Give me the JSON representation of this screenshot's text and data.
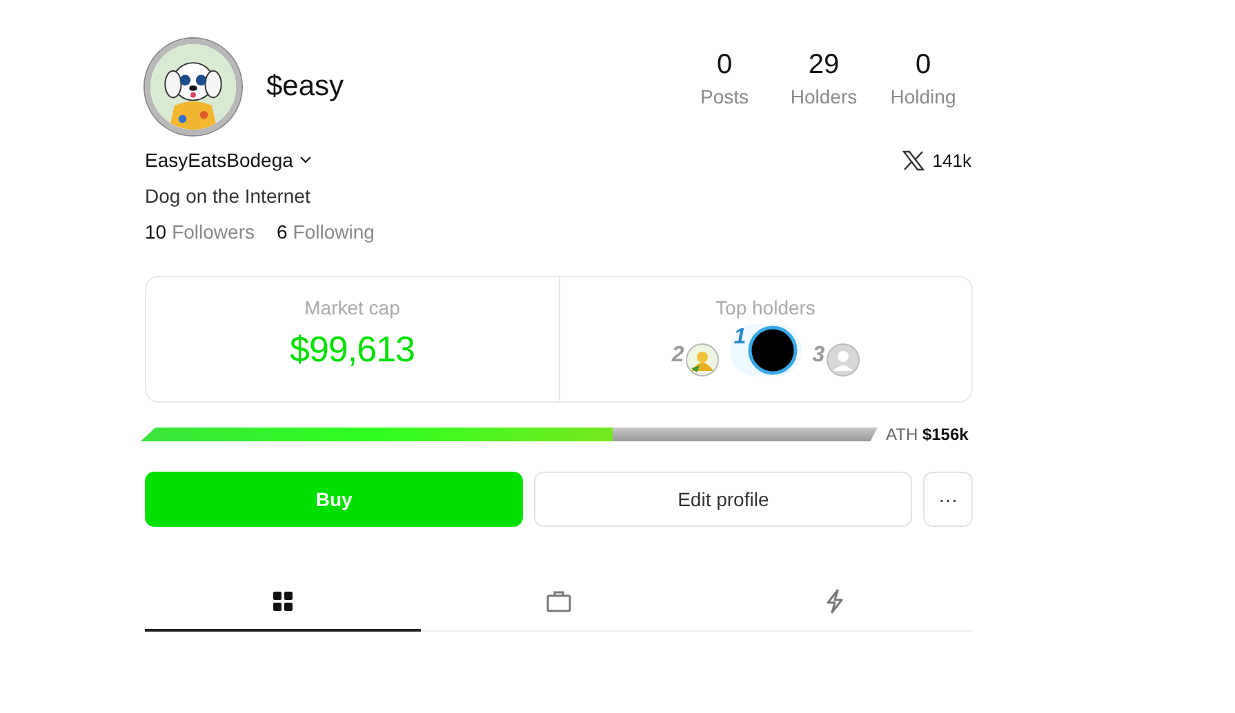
{
  "profile": {
    "ticker": "$easy",
    "username": "EasyEatsBodega",
    "bio": "Dog on the Internet",
    "x_followers": "141k"
  },
  "stats": [
    {
      "value": "0",
      "label": "Posts"
    },
    {
      "value": "29",
      "label": "Holders"
    },
    {
      "value": "0",
      "label": "Holding"
    }
  ],
  "follow": [
    {
      "count": "10",
      "label": "Followers"
    },
    {
      "count": "6",
      "label": "Following"
    }
  ],
  "market_cap": {
    "label": "Market cap",
    "value": "$99,613"
  },
  "top_holders": {
    "label": "Top holders",
    "holders": [
      {
        "rank": "2",
        "kind": "picture",
        "highlighted": false
      },
      {
        "rank": "1",
        "kind": "dark",
        "highlighted": true
      },
      {
        "rank": "3",
        "kind": "default",
        "highlighted": false
      }
    ]
  },
  "progress": {
    "level": 0.64,
    "ath_label": "ATH",
    "ath_value": "$156k"
  },
  "buttons": {
    "buy": "Buy",
    "edit": "Edit profile",
    "more": "···"
  },
  "tabs": [
    {
      "kind": "grid",
      "selected": true
    },
    {
      "kind": "bag",
      "selected": false
    },
    {
      "kind": "bolt",
      "selected": false
    }
  ]
}
